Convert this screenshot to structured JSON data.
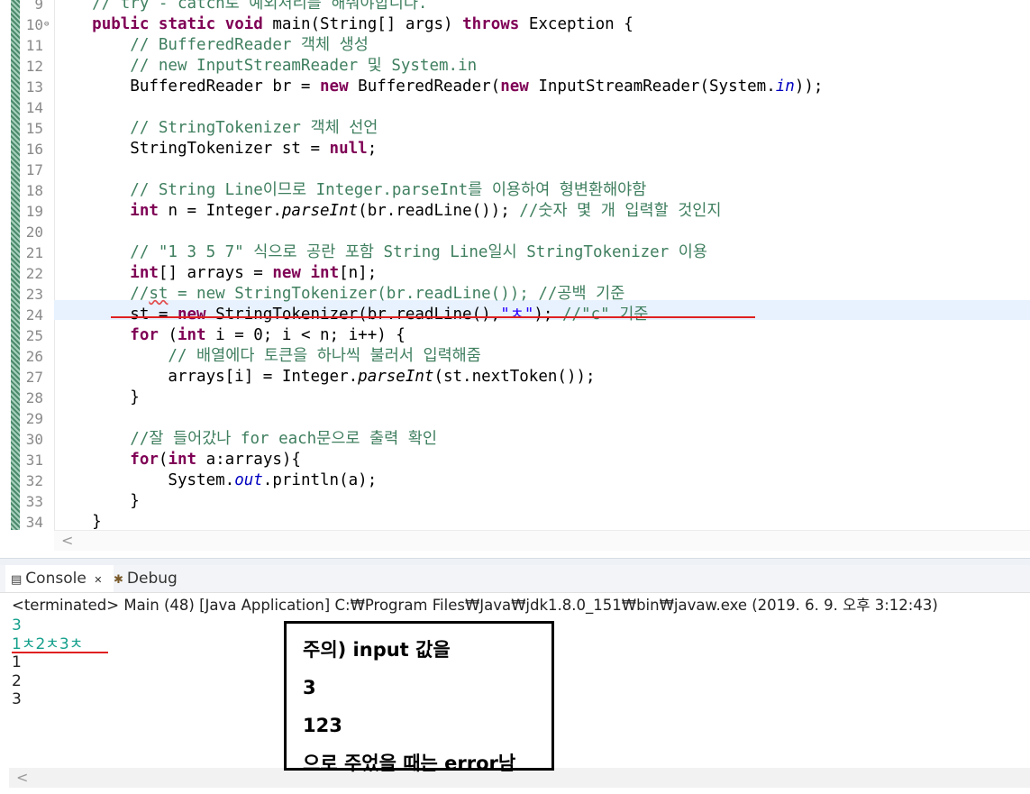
{
  "editor": {
    "line_numbers": [
      "9",
      "10",
      "11",
      "12",
      "13",
      "14",
      "15",
      "16",
      "17",
      "18",
      "19",
      "20",
      "21",
      "22",
      "23",
      "24",
      "25",
      "26",
      "27",
      "28",
      "29",
      "30",
      "31",
      "32",
      "33",
      "34"
    ],
    "fold_marker": "⊖",
    "code": [
      [
        {
          "t": "    // try - catch로 예외처리를 해줘야합니다.",
          "c": "cm"
        }
      ],
      [
        {
          "t": "    "
        },
        {
          "t": "public",
          "c": "kw"
        },
        {
          "t": " "
        },
        {
          "t": "static",
          "c": "kw"
        },
        {
          "t": " "
        },
        {
          "t": "void",
          "c": "kw"
        },
        {
          "t": " main(String[] args) "
        },
        {
          "t": "throws",
          "c": "kw"
        },
        {
          "t": " Exception {"
        }
      ],
      [
        {
          "t": "        // BufferedReader 객체 생성",
          "c": "cm"
        }
      ],
      [
        {
          "t": "        // new InputStreamReader 및 System.in",
          "c": "cm"
        }
      ],
      [
        {
          "t": "        BufferedReader br = "
        },
        {
          "t": "new",
          "c": "kw"
        },
        {
          "t": " BufferedReader("
        },
        {
          "t": "new",
          "c": "kw"
        },
        {
          "t": " InputStreamReader(System."
        },
        {
          "t": "in",
          "c": "fld"
        },
        {
          "t": "));"
        }
      ],
      [
        {
          "t": ""
        }
      ],
      [
        {
          "t": "        // StringTokenizer 객체 선언",
          "c": "cm"
        }
      ],
      [
        {
          "t": "        StringTokenizer st = "
        },
        {
          "t": "null",
          "c": "kw"
        },
        {
          "t": ";"
        }
      ],
      [
        {
          "t": ""
        }
      ],
      [
        {
          "t": "        // String Line이므로 Integer.parseInt를 이용하여 형변환해야함",
          "c": "cm"
        }
      ],
      [
        {
          "t": "        "
        },
        {
          "t": "int",
          "c": "kw"
        },
        {
          "t": " n = Integer."
        },
        {
          "t": "parseInt",
          "c": "it"
        },
        {
          "t": "(br.readLine()); "
        },
        {
          "t": "//숫자 몇 개 입력할 것인지",
          "c": "cm"
        }
      ],
      [
        {
          "t": ""
        }
      ],
      [
        {
          "t": "        // \"1 3 5 7\" 식으로 공란 포함 String Line일시 StringTokenizer 이용",
          "c": "cm"
        }
      ],
      [
        {
          "t": "        "
        },
        {
          "t": "int",
          "c": "kw"
        },
        {
          "t": "[] arrays = "
        },
        {
          "t": "new",
          "c": "kw"
        },
        {
          "t": " "
        },
        {
          "t": "int",
          "c": "kw"
        },
        {
          "t": "[n];"
        }
      ],
      [
        {
          "t": "        //",
          "c": "cm"
        },
        {
          "t": "st",
          "c": "cm sq"
        },
        {
          "t": " = new StringTokenizer(br.readLine()); //공백 기준",
          "c": "cm"
        }
      ],
      [
        {
          "t": "        st = "
        },
        {
          "t": "new",
          "c": "kw"
        },
        {
          "t": " StringTokenizer(br.readLine(),"
        },
        {
          "t": "\"ㅊ\"",
          "c": "st"
        },
        {
          "t": "); "
        },
        {
          "t": "//\"c\" 기준",
          "c": "cm"
        }
      ],
      [
        {
          "t": "        "
        },
        {
          "t": "for",
          "c": "kw"
        },
        {
          "t": " ("
        },
        {
          "t": "int",
          "c": "kw"
        },
        {
          "t": " i = 0; i < n; i++) {"
        }
      ],
      [
        {
          "t": "            // 배열에다 토큰을 하나씩 불러서 입력해줌",
          "c": "cm"
        }
      ],
      [
        {
          "t": "            arrays[i] = Integer."
        },
        {
          "t": "parseInt",
          "c": "it"
        },
        {
          "t": "(st.nextToken());"
        }
      ],
      [
        {
          "t": "        }"
        }
      ],
      [
        {
          "t": ""
        }
      ],
      [
        {
          "t": "        //잘 들어갔나 for each문으로 출력 확인",
          "c": "cm"
        }
      ],
      [
        {
          "t": "        "
        },
        {
          "t": "for",
          "c": "kw"
        },
        {
          "t": "("
        },
        {
          "t": "int",
          "c": "kw"
        },
        {
          "t": " a:arrays){"
        }
      ],
      [
        {
          "t": "            System."
        },
        {
          "t": "out",
          "c": "fld"
        },
        {
          "t": ".println(a);"
        }
      ],
      [
        {
          "t": "        }"
        }
      ],
      [
        {
          "t": "    }"
        }
      ]
    ]
  },
  "tabs": {
    "console_label": "Console",
    "console_close": "✕",
    "debug_label": "Debug"
  },
  "console": {
    "status": "<terminated> Main (48) [Java Application] C:₩Program Files₩Java₩jdk1.8.0_151₩bin₩javaw.exe (2019. 6. 9. 오후 3:12:43)",
    "lines": [
      {
        "text": "3",
        "kind": "in"
      },
      {
        "text": "1ㅊ2ㅊ3ㅊ",
        "kind": "in"
      },
      {
        "text": "1",
        "kind": "out"
      },
      {
        "text": "2",
        "kind": "out"
      },
      {
        "text": "3",
        "kind": "out"
      }
    ]
  },
  "note": {
    "lines": [
      "주의) input 값을",
      "3",
      "123",
      "으로 주었을 때는 error남"
    ]
  },
  "colors": {
    "keyword": "#7f0055",
    "comment": "#3f7f5f",
    "string": "#2a00ff",
    "field": "#0000c0",
    "console_input": "#15a08c",
    "annotation_red": "#e02020",
    "current_line": "#e8f2fe"
  }
}
